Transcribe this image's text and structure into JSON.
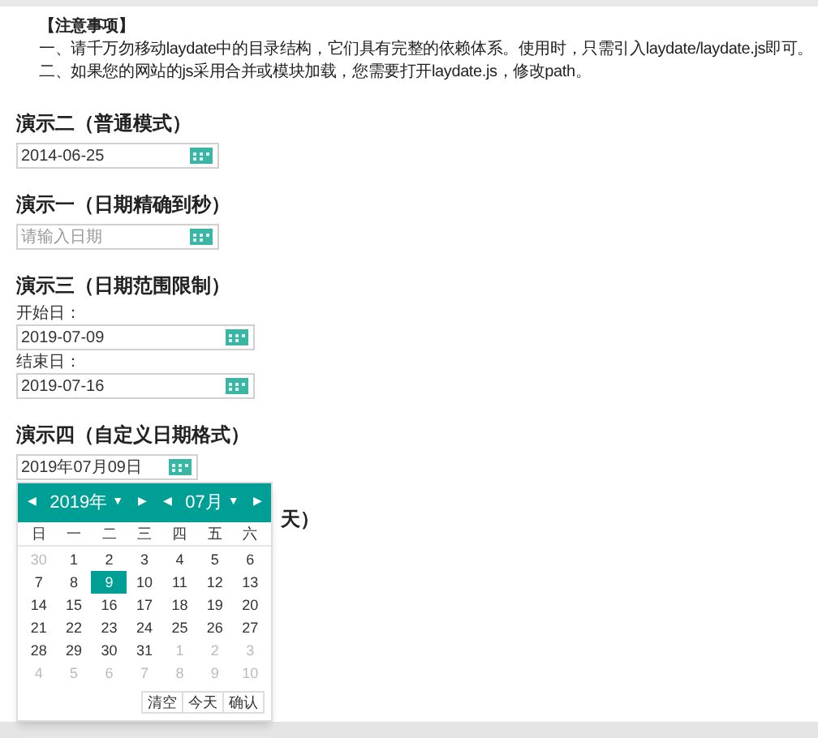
{
  "notes": {
    "title": "【注意事项】",
    "lines": [
      "一、请千万勿移动laydate中的目录结构，它们具有完整的依赖体系。使用时，只需引入laydate/laydate.js即可。",
      "二、如果您的网站的js采用合并或模块加载，您需要打开laydate.js，修改path。"
    ]
  },
  "demos": [
    {
      "title": "演示二（普通模式）",
      "fields": [
        {
          "value": "2014-06-25"
        }
      ]
    },
    {
      "title": "演示一（日期精确到秒）",
      "fields": [
        {
          "placeholder": "请输入日期"
        }
      ]
    },
    {
      "title": "演示三（日期范围限制）",
      "fields": [
        {
          "label": "开始日：",
          "value": "2019-07-09"
        },
        {
          "label": "结束日：",
          "value": "2019-07-16"
        }
      ]
    },
    {
      "title": "演示四（自定义日期格式）",
      "fields": [
        {
          "value": "2019年07月09日"
        }
      ]
    }
  ],
  "hidden_heading_tail": "天）",
  "calendar": {
    "year": "2019年",
    "month": "07月",
    "prev": "◀",
    "next": "▶",
    "caret": "▼",
    "weekdays": [
      "日",
      "一",
      "二",
      "三",
      "四",
      "五",
      "六"
    ],
    "days": [
      {
        "text": "30",
        "kind": "other",
        "selected": false
      },
      {
        "text": "1",
        "kind": "current",
        "selected": false
      },
      {
        "text": "2",
        "kind": "current",
        "selected": false
      },
      {
        "text": "3",
        "kind": "current",
        "selected": false
      },
      {
        "text": "4",
        "kind": "current",
        "selected": false
      },
      {
        "text": "5",
        "kind": "current",
        "selected": false
      },
      {
        "text": "6",
        "kind": "current",
        "selected": false
      },
      {
        "text": "7",
        "kind": "current",
        "selected": false
      },
      {
        "text": "8",
        "kind": "current",
        "selected": false
      },
      {
        "text": "9",
        "kind": "current",
        "selected": true
      },
      {
        "text": "10",
        "kind": "current",
        "selected": false
      },
      {
        "text": "11",
        "kind": "current",
        "selected": false
      },
      {
        "text": "12",
        "kind": "current",
        "selected": false
      },
      {
        "text": "13",
        "kind": "current",
        "selected": false
      },
      {
        "text": "14",
        "kind": "current",
        "selected": false
      },
      {
        "text": "15",
        "kind": "current",
        "selected": false
      },
      {
        "text": "16",
        "kind": "current",
        "selected": false
      },
      {
        "text": "17",
        "kind": "current",
        "selected": false
      },
      {
        "text": "18",
        "kind": "current",
        "selected": false
      },
      {
        "text": "19",
        "kind": "current",
        "selected": false
      },
      {
        "text": "20",
        "kind": "current",
        "selected": false
      },
      {
        "text": "21",
        "kind": "current",
        "selected": false
      },
      {
        "text": "22",
        "kind": "current",
        "selected": false
      },
      {
        "text": "23",
        "kind": "current",
        "selected": false
      },
      {
        "text": "24",
        "kind": "current",
        "selected": false
      },
      {
        "text": "25",
        "kind": "current",
        "selected": false
      },
      {
        "text": "26",
        "kind": "current",
        "selected": false
      },
      {
        "text": "27",
        "kind": "current",
        "selected": false
      },
      {
        "text": "28",
        "kind": "current",
        "selected": false
      },
      {
        "text": "29",
        "kind": "current",
        "selected": false
      },
      {
        "text": "30",
        "kind": "current",
        "selected": false
      },
      {
        "text": "31",
        "kind": "current",
        "selected": false
      },
      {
        "text": "1",
        "kind": "other",
        "selected": false
      },
      {
        "text": "2",
        "kind": "other",
        "selected": false
      },
      {
        "text": "3",
        "kind": "other",
        "selected": false
      },
      {
        "text": "4",
        "kind": "other",
        "selected": false
      },
      {
        "text": "5",
        "kind": "other",
        "selected": false
      },
      {
        "text": "6",
        "kind": "other",
        "selected": false
      },
      {
        "text": "7",
        "kind": "other",
        "selected": false
      },
      {
        "text": "8",
        "kind": "other",
        "selected": false
      },
      {
        "text": "9",
        "kind": "other",
        "selected": false
      },
      {
        "text": "10",
        "kind": "other",
        "selected": false
      }
    ],
    "buttons": [
      "清空",
      "今天",
      "确认"
    ]
  }
}
